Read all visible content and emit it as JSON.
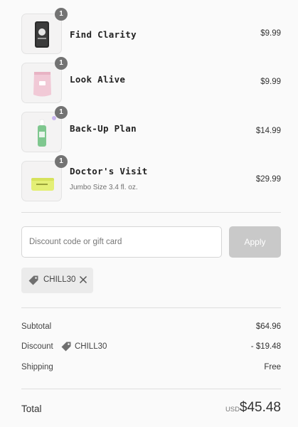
{
  "items": [
    {
      "name": "Find Clarity",
      "variant": "",
      "price": "$9.99",
      "quantity": "1",
      "image": "black-cream-jar-image"
    },
    {
      "name": "Look Alive",
      "variant": "",
      "price": "$9.99",
      "quantity": "1",
      "image": "pink-pouch-image"
    },
    {
      "name": "Back-Up Plan",
      "variant": "",
      "price": "$14.99",
      "quantity": "1",
      "image": "green-dropper-bottle-image"
    },
    {
      "name": "Doctor's Visit",
      "variant": "Jumbo Size 3.4 fl. oz.",
      "price": "$29.99",
      "quantity": "1",
      "image": "yellow-jar-image"
    }
  ],
  "discount": {
    "placeholder": "Discount code or gift card",
    "value": "",
    "apply_label": "Apply",
    "applied_code": "CHILL30"
  },
  "summary": {
    "subtotal_label": "Subtotal",
    "subtotal_value": "$64.96",
    "discount_label": "Discount",
    "discount_code": "CHILL30",
    "discount_value": "- $19.48",
    "shipping_label": "Shipping",
    "shipping_value": "Free",
    "total_label": "Total",
    "currency": "USD",
    "total_value": "$45.48"
  },
  "colors": {
    "background": "#fafafa",
    "quantity_badge": "#737373",
    "apply_disabled": "#c9c9c9",
    "tag_chip": "#ebebeb"
  }
}
